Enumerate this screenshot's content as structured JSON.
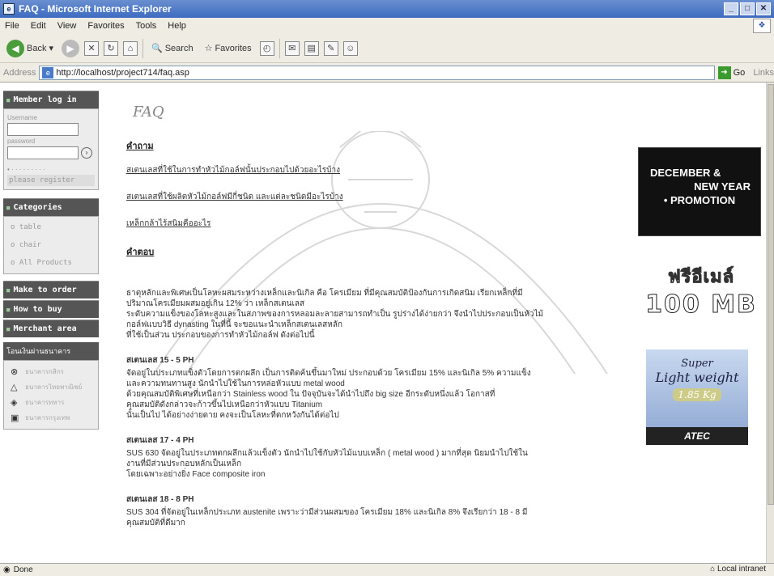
{
  "window": {
    "title": "FAQ - Microsoft Internet Explorer",
    "controls": [
      "_",
      "□",
      "✕"
    ]
  },
  "menu": [
    "File",
    "Edit",
    "View",
    "Favorites",
    "Tools",
    "Help"
  ],
  "toolbar": {
    "back": "Back",
    "search": "Search",
    "favorites": "Favorites"
  },
  "address": {
    "label": "Address",
    "url": "http://localhost/project714/faq.asp",
    "go": "Go",
    "links": "Links"
  },
  "sidebar": {
    "member_title": "Member log in",
    "username_label": "Username",
    "password_label": "password",
    "register": "please register",
    "categories_title": "Categories",
    "categories": [
      "o table",
      "o chair",
      "o All Products"
    ],
    "make_order": "Make to order",
    "how_to_buy": "How to buy",
    "merchant": "Merchant area",
    "payment_title": "โอนเงินผ่านธนาคาร",
    "banks": [
      "ธนาคารกสิกร",
      "ธนาคารไทยพาณิชย์",
      "ธนาคารทหาร",
      "ธนาคารกรุงเทพ"
    ]
  },
  "main": {
    "logo": "FAQ",
    "question_head": "คำถาม",
    "questions": [
      "สเตนเลสที่ใช้ในการทำหัวไม้กอล์ฟนั้นประกอบไปด้วยอะไรบ้าง",
      "สเตนเลสที่ใช้ผลิตหัวไม้กอล์ฟมีกี่ชนิด และแต่ละชนิดมีอะไรบ้าง",
      "เหล็กกล้าไร้สนิมคืออะไร"
    ],
    "answer_head": "คำตอบ",
    "answers": [
      {
        "head": "",
        "lines": [
          "ธาตุหลักและพิเศษเป็นโลหะผสมระหว่างเหล็กและนิเกิล คือ โครเมียม ที่มีคุณสมบัติป้องกันการเกิดสนิม เรียกเหล็กที่มี",
          "ปริมาณโครเมียมผสมอยู่เกิน 12% ว่า เหล็กสเตนเลส",
          "ระดับความแข็งของโลหะสูงและในสภาพของการหลอมละลายสามารถทำเป็น รูปร่างได้ง่ายกว่า จึงนำไปประกอบเป็นหัวไม้",
          "กอล์ฟแบบวิธี dynasting ในที่นี้ จะขอแนะนำเหล็กสเตนเลสหลัก",
          "ที่ใช้เป็นส่วน ประกอบของการทำหัวไม้กอล์ฟ ดังต่อไปนี้"
        ]
      },
      {
        "head": "สเตนเลส 15 - 5 PH",
        "lines": [
          "จัดอยู่ในประเภทแข็งตัวโดยการตกผลึก เป็นการติดค้นขึ้นมาใหม่ ประกอบด้วย โครเมียม 15% และนิเกิล 5% ความแข็ง",
          "และความทนทานสูง นักนำไปใช้ในการหล่อหัวแบบ metal wood",
          "ด้วยคุณสมบัติพิเศษที่เหนือกว่า Stainless wood ใน ปัจจุบันจะได้นำไปถึง big size อีกระดับหนึ่งแล้ว โอกาสที่",
          "คุณสมบัติดังกล่าวจะก้าวขึ้นไปเหนือกว่าหัวแบบ Titanium",
          "นั้นเป็นไป ได้อย่างง่ายดาย คงจะเป็นโลหะที่ตกหวังกันได้ต่อไป"
        ]
      },
      {
        "head": "สเตนเลส 17 - 4 PH",
        "lines": [
          "SUS 630 จัดอยู่ในประเภทตกผลึกแล้วแข็งตัว นักนำไปใช้กับหัวไม้แบบเหล็ก ( metal wood ) มากที่สุด นิยมนำไปใช้ใน",
          "งานที่มีส่วนประกอบหลักเป็นเหล็ก",
          "โดยเฉพาะอย่างยิ่ง Face composite iron"
        ]
      },
      {
        "head": "สเตนเลส 18 - 8 PH",
        "lines": [
          "SUS 304 ที่จัดอยู่ในเหล็กประเภท austenite เพราะว่ามีส่วนผสมของ โครเมียม 18% และนิเกิล 8% จึงเรียกว่า 18 - 8 มี",
          "คุณสมบัติที่ดีมาก"
        ]
      }
    ]
  },
  "ads": {
    "promo": [
      "DECEMBER &",
      "NEW YEAR",
      "• PROMOTION"
    ],
    "free_label": "ฟรีอีเมล์",
    "free_size": "100 MB",
    "super": "Super",
    "light": "Light weight",
    "kg": "1.85 Kg",
    "brand": "ATEC"
  },
  "status": {
    "left": "Done",
    "right": "Local intranet"
  },
  "colors": {
    "titlebar": "#3d6bc0",
    "sidebar_head": "#555555",
    "chrome": "#efece3"
  }
}
